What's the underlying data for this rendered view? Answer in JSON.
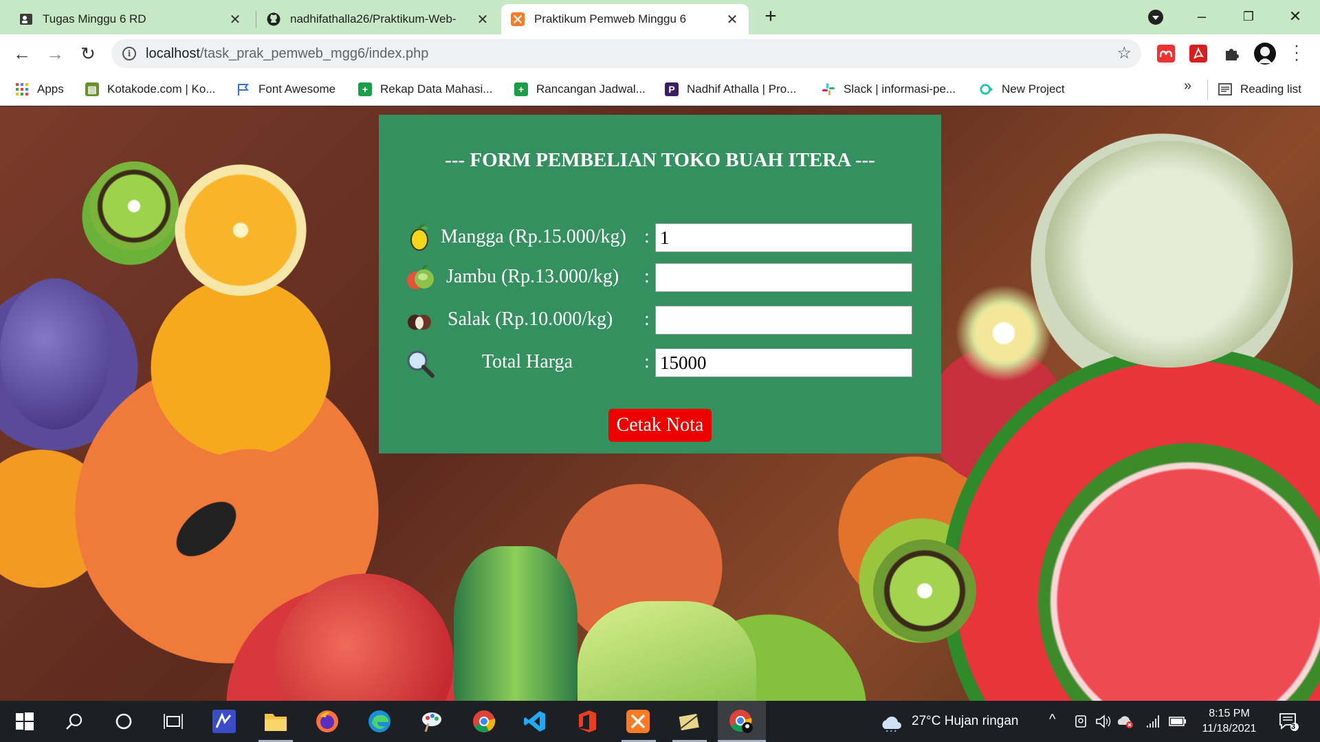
{
  "browser": {
    "tabs": [
      {
        "title": "Tugas Minggu 6 RD",
        "icon": "document-person-icon",
        "active": false
      },
      {
        "title": "nadhifathalla26/Praktikum-Web-",
        "icon": "github-icon",
        "active": false
      },
      {
        "title": "Praktikum Pemweb Minggu 6",
        "icon": "xampp-icon",
        "active": true
      }
    ],
    "address": {
      "host": "localhost",
      "path": "/task_prak_pemweb_mgg6/index.php"
    },
    "bookmarks": [
      {
        "label": "Apps",
        "icon": "apps-grid-icon"
      },
      {
        "label": "Kotakode.com | Ko...",
        "icon": "kotakode-icon"
      },
      {
        "label": "Font Awesome",
        "icon": "flag-icon"
      },
      {
        "label": "Rekap Data Mahasi...",
        "icon": "sheets-icon"
      },
      {
        "label": "Rancangan Jadwal...",
        "icon": "sheets-icon"
      },
      {
        "label": "Nadhif Athalla | Pro...",
        "icon": "profile-icon"
      },
      {
        "label": "Slack | informasi-pe...",
        "icon": "slack-icon"
      },
      {
        "label": "New Project",
        "icon": "project-icon"
      }
    ],
    "reading_list": "Reading list",
    "more_bookmarks": "»"
  },
  "form": {
    "title": "--- FORM PEMBELIAN TOKO BUAH ITERA ---",
    "rows": [
      {
        "label": "Mangga (Rp.15.000/kg)",
        "value": "1",
        "icon": "mango-icon"
      },
      {
        "label": "Jambu (Rp.13.000/kg)",
        "value": "",
        "icon": "guava-icon"
      },
      {
        "label": "Salak (Rp.10.000/kg)",
        "value": "",
        "icon": "salak-icon"
      },
      {
        "label": "Total Harga",
        "value": "15000",
        "icon": "magnifier-icon"
      }
    ],
    "colon": ":",
    "submit_label": "Cetak Nota"
  },
  "taskbar": {
    "weather": "27°C  Hujan ringan",
    "time": "8:15 PM",
    "date": "11/18/2021",
    "notification_count": "3"
  },
  "colors": {
    "form_bg": "#35905f",
    "button_bg": "#ee0000",
    "tabstrip_bg": "#c6e8c4"
  }
}
